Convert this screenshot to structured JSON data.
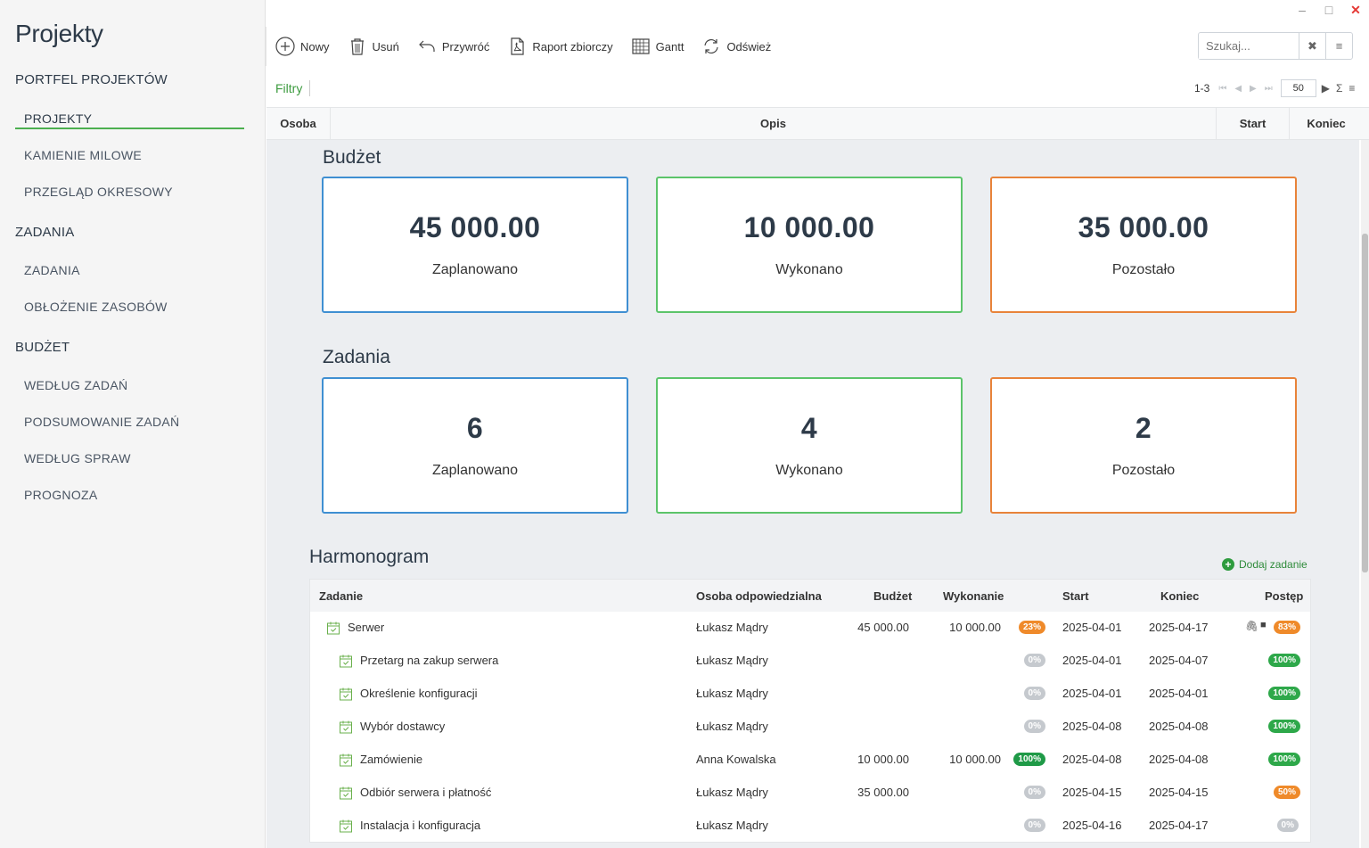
{
  "window": {
    "minimize": "–",
    "maximize": "□",
    "close": "✕"
  },
  "sidebar": {
    "title": "Projekty",
    "groups": [
      {
        "label": "PORTFEL PROJEKTÓW"
      },
      {
        "label": "ZADANIA"
      },
      {
        "label": "BUDŻET"
      }
    ],
    "items": [
      {
        "label": "PROJEKTY",
        "active": true
      },
      {
        "label": "KAMIENIE MILOWE"
      },
      {
        "label": "PRZEGLĄD OKRESOWY"
      },
      {
        "label": "ZADANIA"
      },
      {
        "label": "OBŁOŻENIE ZASOBÓW"
      },
      {
        "label": "WEDŁUG ZADAŃ"
      },
      {
        "label": "PODSUMOWANIE ZADAŃ"
      },
      {
        "label": "WEDŁUG SPRAW"
      },
      {
        "label": "PROGNOZA"
      }
    ]
  },
  "toolbar": {
    "new_label": "Nowy",
    "delete_label": "Usuń",
    "restore_label": "Przywróć",
    "report_label": "Raport zbiorczy",
    "gantt_label": "Gantt",
    "refresh_label": "Odśwież"
  },
  "search": {
    "placeholder": "Szukaj..."
  },
  "filters": {
    "label": "Filtry"
  },
  "pager": {
    "range": "1-3",
    "page_size": "50",
    "sum_icon": "Σ"
  },
  "grid": {
    "columns": [
      "Osoba",
      "Opis",
      "Start",
      "Koniec"
    ]
  },
  "budget": {
    "title": "Budżet",
    "cards": [
      {
        "value": "45 000.00",
        "label": "Zaplanowano"
      },
      {
        "value": "10 000.00",
        "label": "Wykonano"
      },
      {
        "value": "35 000.00",
        "label": "Pozostało"
      }
    ]
  },
  "tasks": {
    "title": "Zadania",
    "cards": [
      {
        "value": "6",
        "label": "Zaplanowano"
      },
      {
        "value": "4",
        "label": "Wykonano"
      },
      {
        "value": "2",
        "label": "Pozostało"
      }
    ]
  },
  "schedule": {
    "title": "Harmonogram",
    "add_label": "Dodaj zadanie",
    "columns": {
      "task": "Zadanie",
      "owner": "Osoba odpowiedzialna",
      "budget": "Budżet",
      "execution": "Wykonanie",
      "start": "Start",
      "end": "Koniec",
      "progress": "Postęp"
    },
    "rows": [
      {
        "task": "Serwer",
        "owner": "Łukasz Mądry",
        "budget": "45 000.00",
        "execution": "10 000.00",
        "exec_pct": "23%",
        "start": "2025-04-01",
        "end": "2025-04-17",
        "progress": "83%"
      },
      {
        "task": "Przetarg na zakup serwera",
        "owner": "Łukasz Mądry",
        "budget": "",
        "execution": "",
        "exec_pct": "0%",
        "start": "2025-04-01",
        "end": "2025-04-07",
        "progress": "100%"
      },
      {
        "task": "Określenie konfiguracji",
        "owner": "Łukasz Mądry",
        "budget": "",
        "execution": "",
        "exec_pct": "0%",
        "start": "2025-04-01",
        "end": "2025-04-01",
        "progress": "100%"
      },
      {
        "task": "Wybór dostawcy",
        "owner": "Łukasz Mądry",
        "budget": "",
        "execution": "",
        "exec_pct": "0%",
        "start": "2025-04-08",
        "end": "2025-04-08",
        "progress": "100%"
      },
      {
        "task": "Zamówienie",
        "owner": "Anna Kowalska",
        "budget": "10 000.00",
        "execution": "10 000.00",
        "exec_pct": "100%",
        "start": "2025-04-08",
        "end": "2025-04-08",
        "progress": "100%"
      },
      {
        "task": "Odbiór serwera i płatność",
        "owner": "Łukasz Mądry",
        "budget": "35 000.00",
        "execution": "",
        "exec_pct": "0%",
        "start": "2025-04-15",
        "end": "2025-04-15",
        "progress": "50%"
      },
      {
        "task": "Instalacja i konfiguracja",
        "owner": "Łukasz Mądry",
        "budget": "",
        "execution": "",
        "exec_pct": "0%",
        "start": "2025-04-16",
        "end": "2025-04-17",
        "progress": "0%"
      }
    ]
  },
  "colors": {
    "accent_green": "#4caf50",
    "card_blue": "#3f8fd2",
    "card_green": "#5cc46a",
    "card_orange": "#e8833a"
  }
}
